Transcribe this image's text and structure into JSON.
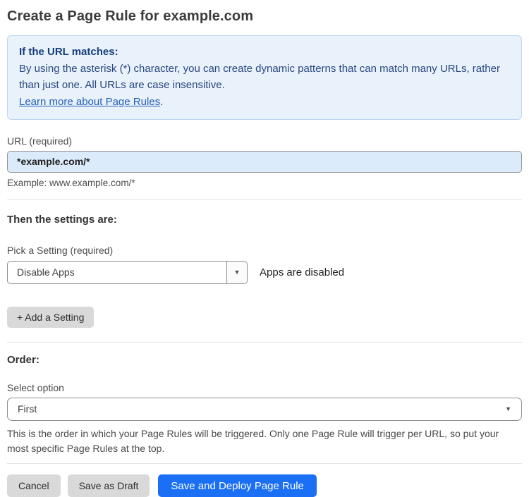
{
  "page": {
    "title": "Create a Page Rule for example.com"
  },
  "info_box": {
    "heading": "If the URL matches:",
    "body": "By using the asterisk (*) character, you can create dynamic patterns that can match many URLs, rather than just one. All URLs are case insensitive.",
    "link_label": "Learn more about Page Rules",
    "link_suffix": "."
  },
  "url_field": {
    "label": "URL (required)",
    "value": "*example.com/*",
    "example": "Example: www.example.com/*"
  },
  "settings_section": {
    "heading": "Then the settings are:",
    "picker_label": "Pick a Setting (required)",
    "selected_setting": "Disable Apps",
    "status_text": "Apps are disabled",
    "add_button_label": "+ Add a Setting"
  },
  "order_section": {
    "heading": "Order:",
    "label": "Select option",
    "selected_option": "First",
    "help_text": "This is the order in which your Page Rules will be triggered. Only one Page Rule will trigger per URL, so put your most specific Page Rules at the top."
  },
  "actions": {
    "cancel_label": "Cancel",
    "save_draft_label": "Save as Draft",
    "save_deploy_label": "Save and Deploy Page Rule"
  },
  "icons": {
    "dropdown_caret": "▼"
  },
  "colors": {
    "accent_blue": "#1a6ff5",
    "info_box_bg": "#e9f1fb",
    "info_box_border": "#bdd7f1",
    "info_text": "#27477f",
    "link_blue": "#2161b8",
    "input_bg": "#dcebfb",
    "button_gray": "#d9d9d9"
  }
}
